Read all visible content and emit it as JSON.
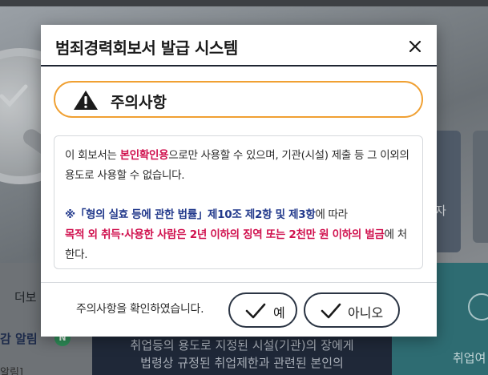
{
  "background": {
    "card_text": "자",
    "section_title": "더보",
    "alert_link": "감 알림",
    "alert_badge": "N",
    "alert_sub": "알림]",
    "mid_text_line1": "취업등의 용도로 지정된 시설(기관)의 장에게",
    "mid_text_line2": "법령상 규정된 취업제한과 관련된 본인의",
    "right_text": "취업여"
  },
  "modal": {
    "title": "범죄경력회보서 발급 시스템",
    "close_icon": "close-icon",
    "notice": {
      "icon": "warning-icon",
      "title": "주의사항"
    },
    "content": {
      "p1_a": "이 회보서는 ",
      "p1_hl": "본인확인용",
      "p1_b": "으로만 사용할 수 있으며, 기관(시설) 제출 등 그 이외의 용도로 사용할 수 없습니다.",
      "p2_a": "※「형의 실효 등에 관한 법률」제10조 제2항 및 제3항",
      "p2_b": "에 따라",
      "p2_hl": "목적 외 취득·사용한 사람은 2년 이하의 징역 또는 2천만 원 이하의 벌금",
      "p2_c": "에 처한다."
    },
    "footer": {
      "label": "주의사항을 확인하였습니다.",
      "yes_label": "예",
      "no_label": "아니오",
      "check_icon": "check-icon"
    }
  },
  "colors": {
    "accent_orange": "#f0a032",
    "highlight_red": "#d0114e",
    "highlight_navy": "#233a8c",
    "header_border": "#1e2532"
  }
}
